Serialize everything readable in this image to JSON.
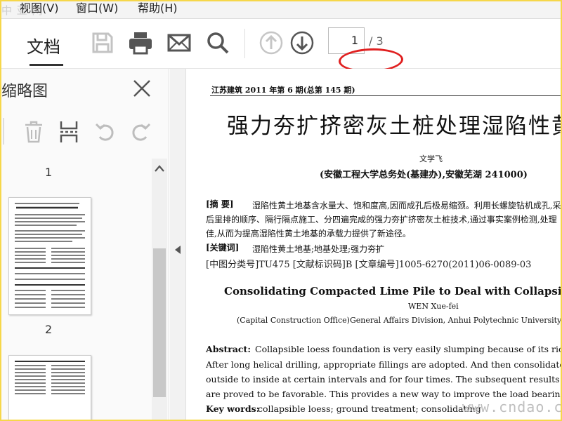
{
  "watermark_top": "中  亚  网",
  "menu": {
    "items": [
      {
        "label": "视图(V)"
      },
      {
        "label": "窗口(W)"
      },
      {
        "label": "帮助(H)"
      }
    ]
  },
  "toolbar": {
    "doc_tab_label": "文档",
    "page_current": "1",
    "page_total": "/ 3",
    "highlight_color": "#e02020"
  },
  "sidebar": {
    "title": "缩略图",
    "thumbnails": [
      {
        "number": "1"
      },
      {
        "number": "2"
      }
    ]
  },
  "document": {
    "journal_line": "江苏建筑      2011 年第 6 期(总第 145 期)",
    "title_cn": "强力夯扩挤密灰土桩处理湿陷性黄",
    "author_cn": "文学飞",
    "affiliation_cn": "(安徽工程大学总务处(基建办),安徽芜湖   241000)",
    "abstract_label": "[摘    要]",
    "abstract_lines": [
      "湿陷性黄土地基含水量大、饱和度高,因而成孔后极易缩颈。利用长螺旋钻机成孔,采",
      "后里排的顺序、隔行隔点施工、分四遍完成的强力夯扩挤密灰土桩技术,通过事实案例检测,处理",
      "佳,从而为提高湿陷性黄土地基的承载力提供了新途径。"
    ],
    "keywords_label": "[关键词]",
    "keywords": "湿陷性黄土地基;地基处理;强力夯扩",
    "classification": "[中图分类号]TU475    [文献标识码]B    [文章编号]1005-6270(2011)06-0089-03",
    "title_en": "Consolidating Compacted Lime Pile to Deal with Collapsibility of Lo",
    "author_en": "WEN Xue-fei",
    "affiliation_en": "(Capital Construction Office)General Affairs Division, Anhui Polytechnic University, Wuhu An",
    "abstract_en_label": "Abstract:",
    "abstract_en_lines": [
      "Collapsible loess foundation is very easily slumping because of its rich wat",
      "After long helical drilling, appropriate fillings are adopted. And then consolidate the co",
      "outside to inside at certain intervals and for four times.  The subsequent results obtain",
      "are proved to be favorable. This provides a new way to improve the load bearing of colla"
    ],
    "keywords_en_label": "Key words:",
    "keywords_en": "collapsible loess; ground treatment; consolidating"
  },
  "watermark_bottom": "www.cndao.com"
}
